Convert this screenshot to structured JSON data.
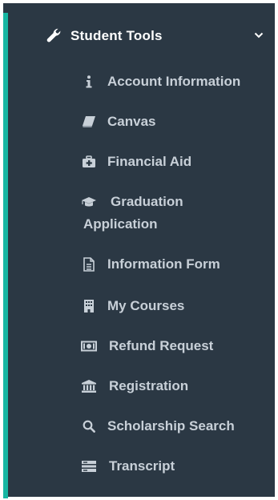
{
  "menu": {
    "header": {
      "title": "Student Tools",
      "icon": "wrench-icon",
      "chevron": "chevron-down-icon"
    },
    "items": [
      {
        "label": "Account Information",
        "icon": "info-icon"
      },
      {
        "label": "Canvas",
        "icon": "book-icon"
      },
      {
        "label": "Financial Aid",
        "icon": "medkit-icon"
      },
      {
        "label_line1": "Graduation",
        "label_line2": "Application",
        "icon": "graduation-cap-icon"
      },
      {
        "label": "Information Form",
        "icon": "document-icon"
      },
      {
        "label": "My Courses",
        "icon": "building-icon"
      },
      {
        "label": "Refund Request",
        "icon": "money-icon"
      },
      {
        "label": "Registration",
        "icon": "bank-icon"
      },
      {
        "label": "Scholarship Search",
        "icon": "search-icon"
      },
      {
        "label": "Transcript",
        "icon": "list-icon"
      }
    ]
  },
  "colors": {
    "panel": "#2b3844",
    "accent": "#16b6a2",
    "text": "#c8d0d8",
    "header_text": "#ffffff"
  }
}
